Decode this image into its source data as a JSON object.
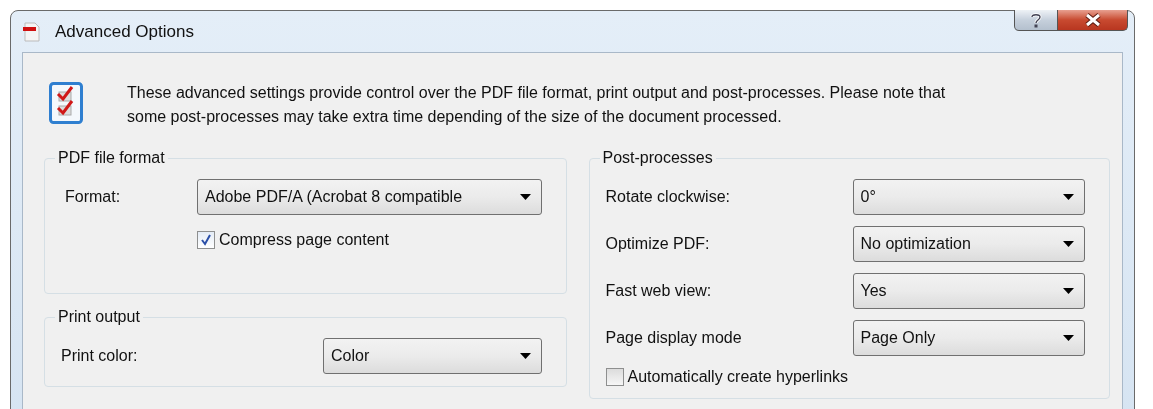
{
  "window": {
    "title": "Advanced Options"
  },
  "description": "These advanced settings provide control over the PDF file format, print output and post-processes. Please note that some post-processes may take extra time depending of the size of the document processed.",
  "left_column": [
    {
      "title": "PDF file format",
      "rows": [
        {
          "kind": "select",
          "label": "Format:",
          "value": "Adobe PDF/A (Acrobat 8 compatible"
        },
        {
          "kind": "checkbox",
          "label": "Compress page content",
          "checked": true
        }
      ]
    },
    {
      "title": "Print output",
      "rows": [
        {
          "kind": "select",
          "label": "Print color:",
          "value": "Color"
        }
      ]
    }
  ],
  "right_column": [
    {
      "title": "Post-processes",
      "rows": [
        {
          "kind": "select",
          "label": "Rotate clockwise:",
          "value": "0°"
        },
        {
          "kind": "select",
          "label": "Optimize PDF:",
          "value": "No optimization"
        },
        {
          "kind": "select",
          "label": "Fast web view:",
          "value": "Yes"
        },
        {
          "kind": "select",
          "label": "Page display mode",
          "value": "Page Only"
        },
        {
          "kind": "checkbox",
          "label": "Automatically create hyperlinks",
          "checked": false
        }
      ]
    }
  ]
}
